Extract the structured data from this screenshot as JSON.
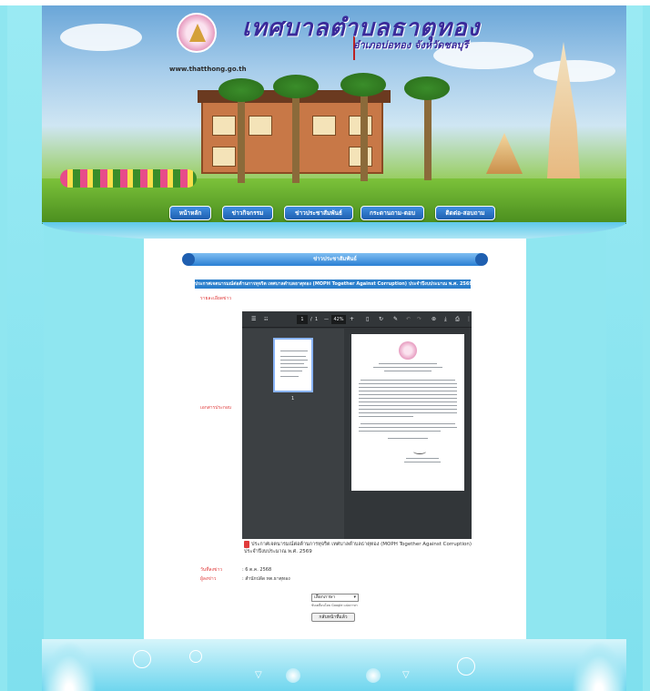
{
  "header": {
    "site_title": "เทศบาลตำบลธาตุทอง",
    "site_subtitle": "อำเภอบ่อทอง จังหวัดชลบุรี",
    "site_url": "www.thatthong.go.th"
  },
  "nav": {
    "items": [
      {
        "label": "หน้าหลัก"
      },
      {
        "label": "ข่าวกิจกรรม"
      },
      {
        "label": "ข่าวประชาสัมพันธ์"
      },
      {
        "label": "กระดานถาม-ตอบ"
      },
      {
        "label": "ติดต่อ-สอบถาม"
      }
    ]
  },
  "section": {
    "header": "ข่าวประชาสัมพันธ์"
  },
  "news": {
    "title": "ประกาศเจตนารมณ์ต่อต้านการทุจริต เทศบาลตำบลธาตุทอง (MOPH Together Against Corruption) ประจำปีงบประมาณ พ.ศ. 2569",
    "detail_label": "รายละเอียดข่าว",
    "document_label": "เอกสารประกอบ",
    "attachment_text": "ประกาศเจตนารมณ์ต่อต้านการทุจริต เทศบาลตำบลธาตุทอง (MOPH Together Against Corruption) ประจำปีงบประมาณ พ.ศ. 2569",
    "date_label": "วันที่ลงข่าว",
    "date_value": ": 6 ต.ค. 2568",
    "author_label": "ผู้ลงข่าว",
    "author_value": ": สำนักปลัด ทต.ธาตุทอง"
  },
  "pdf_viewer": {
    "menu_icon": "☰",
    "page_current": "1",
    "page_separator": "/",
    "page_total": "1",
    "zoom_out": "—",
    "zoom_value": "42%",
    "zoom_in": "+",
    "thumbnail_number": "1"
  },
  "language": {
    "select_value": "เลือกภาษา",
    "credit": "ขับเคลื่อนโดย Google แปลภาษา"
  },
  "back_button": "กลับหน้าที่แล้ว",
  "colors": {
    "accent": "#2b7fcc",
    "label_red": "#e03b3b",
    "background": "#8fe6f0"
  }
}
